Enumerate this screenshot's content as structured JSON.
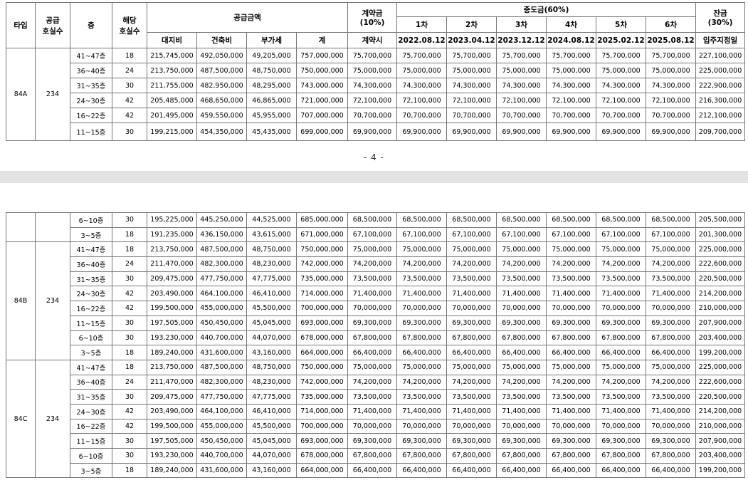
{
  "header": {
    "type": "타입",
    "supply_units": "공급\n호실수",
    "floor": "층",
    "floor_units": "해당\n호실수",
    "supply_amount": "공급금액",
    "deposit": "계약금\n(10%)",
    "interim": "중도금(60%)",
    "balance": "잔금\n(30%)",
    "land": "대지비",
    "building": "건축비",
    "vat": "부가세",
    "total": "계",
    "deposit_when": "계약시",
    "installments": [
      {
        "label": "1차",
        "date": "2022.08.12"
      },
      {
        "label": "2차",
        "date": "2023.04.12"
      },
      {
        "label": "3차",
        "date": "2023.12.12"
      },
      {
        "label": "4차",
        "date": "2024.08.12"
      },
      {
        "label": "5차",
        "date": "2025.02.12"
      },
      {
        "label": "6차",
        "date": "2025.08.12"
      }
    ],
    "balance_when": "입주지정일"
  },
  "page_number": "- 4 -",
  "groups_page1": [
    {
      "type": "84A",
      "units": "234",
      "rows": [
        {
          "floor": "41~47층",
          "n": "18",
          "land": "215,745,000",
          "building": "492,050,000",
          "vat": "49,205,000",
          "total": "757,000,000",
          "deposit": "75,700,000",
          "interim": "75,700,000",
          "balance": "227,100,000"
        },
        {
          "floor": "36~40층",
          "n": "24",
          "land": "213,750,000",
          "building": "487,500,000",
          "vat": "48,750,000",
          "total": "750,000,000",
          "deposit": "75,000,000",
          "interim": "75,000,000",
          "balance": "225,000,000"
        },
        {
          "floor": "31~35층",
          "n": "30",
          "land": "211,755,000",
          "building": "482,950,000",
          "vat": "48,295,000",
          "total": "743,000,000",
          "deposit": "74,300,000",
          "interim": "74,300,000",
          "balance": "222,900,000"
        },
        {
          "floor": "24~30층",
          "n": "42",
          "land": "205,485,000",
          "building": "468,650,000",
          "vat": "46,865,000",
          "total": "721,000,000",
          "deposit": "72,100,000",
          "interim": "72,100,000",
          "balance": "216,300,000"
        },
        {
          "floor": "16~22층",
          "n": "42",
          "land": "201,495,000",
          "building": "459,550,000",
          "vat": "45,955,000",
          "total": "707,000,000",
          "deposit": "70,700,000",
          "interim": "70,700,000",
          "balance": "212,100,000"
        },
        {
          "floor": "11~15층",
          "n": "30",
          "land": "199,215,000",
          "building": "454,350,000",
          "vat": "45,435,000",
          "total": "699,000,000",
          "deposit": "69,900,000",
          "interim": "69,900,000",
          "balance": "209,700,000"
        }
      ]
    }
  ],
  "continued_rows": [
    {
      "floor": "6~10층",
      "n": "30",
      "land": "195,225,000",
      "building": "445,250,000",
      "vat": "44,525,000",
      "total": "685,000,000",
      "deposit": "68,500,000",
      "interim": "68,500,000",
      "balance": "205,500,000"
    },
    {
      "floor": "3~5층",
      "n": "18",
      "land": "191,235,000",
      "building": "436,150,000",
      "vat": "43,615,000",
      "total": "671,000,000",
      "deposit": "67,100,000",
      "interim": "67,100,000",
      "balance": "201,300,000"
    }
  ],
  "groups_page2": [
    {
      "type": "84B",
      "units": "234",
      "rows": [
        {
          "floor": "41~47층",
          "n": "18",
          "land": "213,750,000",
          "building": "487,500,000",
          "vat": "48,750,000",
          "total": "750,000,000",
          "deposit": "75,000,000",
          "interim": "75,000,000",
          "balance": "225,000,000"
        },
        {
          "floor": "36~40층",
          "n": "24",
          "land": "211,470,000",
          "building": "482,300,000",
          "vat": "48,230,000",
          "total": "742,000,000",
          "deposit": "74,200,000",
          "interim": "74,200,000",
          "balance": "222,600,000"
        },
        {
          "floor": "31~35층",
          "n": "30",
          "land": "209,475,000",
          "building": "477,750,000",
          "vat": "47,775,000",
          "total": "735,000,000",
          "deposit": "73,500,000",
          "interim": "73,500,000",
          "balance": "220,500,000"
        },
        {
          "floor": "24~30층",
          "n": "42",
          "land": "203,490,000",
          "building": "464,100,000",
          "vat": "46,410,000",
          "total": "714,000,000",
          "deposit": "71,400,000",
          "interim": "71,400,000",
          "balance": "214,200,000"
        },
        {
          "floor": "16~22층",
          "n": "42",
          "land": "199,500,000",
          "building": "455,000,000",
          "vat": "45,500,000",
          "total": "700,000,000",
          "deposit": "70,000,000",
          "interim": "70,000,000",
          "balance": "210,000,000"
        },
        {
          "floor": "11~15층",
          "n": "30",
          "land": "197,505,000",
          "building": "450,450,000",
          "vat": "45,045,000",
          "total": "693,000,000",
          "deposit": "69,300,000",
          "interim": "69,300,000",
          "balance": "207,900,000"
        },
        {
          "floor": "6~10층",
          "n": "30",
          "land": "193,230,000",
          "building": "440,700,000",
          "vat": "44,070,000",
          "total": "678,000,000",
          "deposit": "67,800,000",
          "interim": "67,800,000",
          "balance": "203,400,000"
        },
        {
          "floor": "3~5층",
          "n": "18",
          "land": "189,240,000",
          "building": "431,600,000",
          "vat": "43,160,000",
          "total": "664,000,000",
          "deposit": "66,400,000",
          "interim": "66,400,000",
          "balance": "199,200,000"
        }
      ]
    },
    {
      "type": "84C",
      "units": "234",
      "rows": [
        {
          "floor": "41~47층",
          "n": "18",
          "land": "213,750,000",
          "building": "487,500,000",
          "vat": "48,750,000",
          "total": "750,000,000",
          "deposit": "75,000,000",
          "interim": "75,000,000",
          "balance": "225,000,000"
        },
        {
          "floor": "36~40층",
          "n": "24",
          "land": "211,470,000",
          "building": "482,300,000",
          "vat": "48,230,000",
          "total": "742,000,000",
          "deposit": "74,200,000",
          "interim": "74,200,000",
          "balance": "222,600,000"
        },
        {
          "floor": "31~35층",
          "n": "30",
          "land": "209,475,000",
          "building": "477,750,000",
          "vat": "47,775,000",
          "total": "735,000,000",
          "deposit": "73,500,000",
          "interim": "73,500,000",
          "balance": "220,500,000"
        },
        {
          "floor": "24~30층",
          "n": "42",
          "land": "203,490,000",
          "building": "464,100,000",
          "vat": "46,410,000",
          "total": "714,000,000",
          "deposit": "71,400,000",
          "interim": "71,400,000",
          "balance": "214,200,000"
        },
        {
          "floor": "16~22층",
          "n": "42",
          "land": "199,500,000",
          "building": "455,000,000",
          "vat": "45,500,000",
          "total": "700,000,000",
          "deposit": "70,000,000",
          "interim": "70,000,000",
          "balance": "210,000,000"
        },
        {
          "floor": "11~15층",
          "n": "30",
          "land": "197,505,000",
          "building": "450,450,000",
          "vat": "45,045,000",
          "total": "693,000,000",
          "deposit": "69,300,000",
          "interim": "69,300,000",
          "balance": "207,900,000"
        },
        {
          "floor": "6~10층",
          "n": "30",
          "land": "193,230,000",
          "building": "440,700,000",
          "vat": "44,070,000",
          "total": "678,000,000",
          "deposit": "67,800,000",
          "interim": "67,800,000",
          "balance": "203,400,000"
        },
        {
          "floor": "3~5층",
          "n": "18",
          "land": "189,240,000",
          "building": "431,600,000",
          "vat": "43,160,000",
          "total": "664,000,000",
          "deposit": "66,400,000",
          "interim": "66,400,000",
          "balance": "199,200,000"
        }
      ]
    }
  ]
}
